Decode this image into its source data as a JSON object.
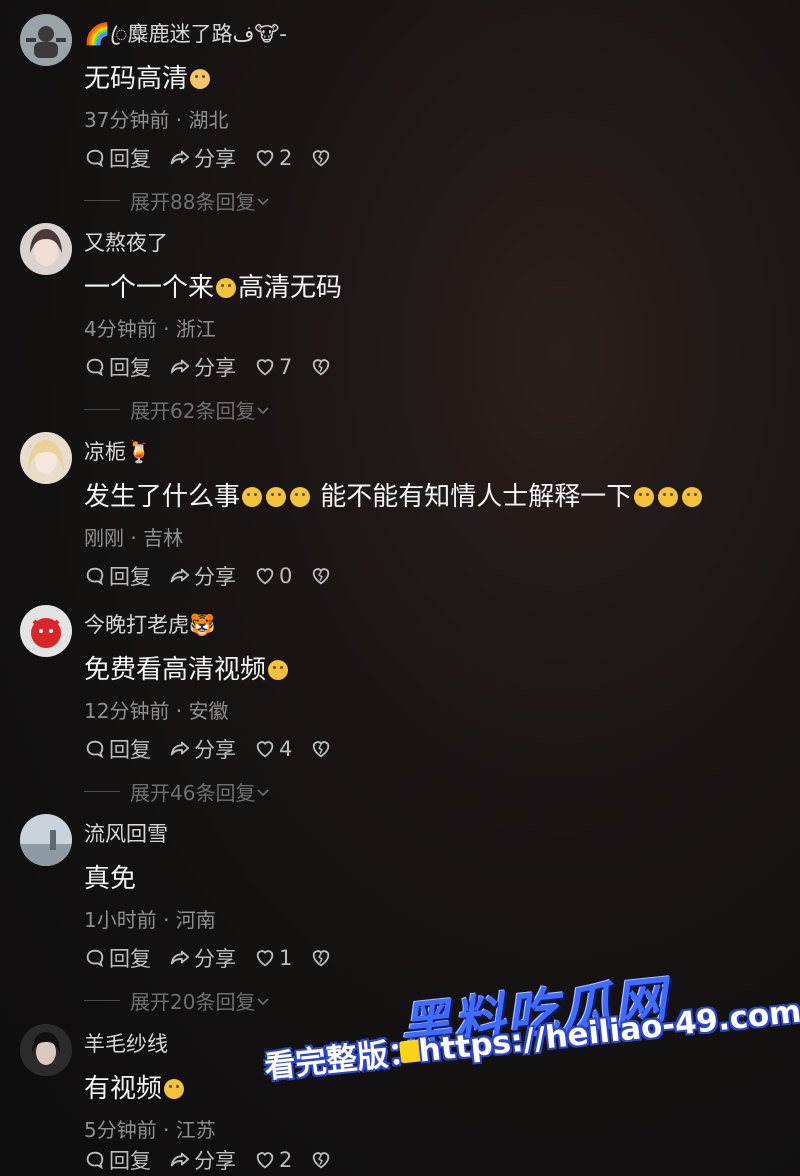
{
  "comments": [
    {
      "name": "🌈ꦿ麋鹿迷了路ف🐮-",
      "text": "无码高清",
      "emoji_after": "cat-face",
      "time_location": "37分钟前 · 湖北",
      "reply_label": "回复",
      "share_label": "分享",
      "likes": "2",
      "expand_replies": "展开88条回复"
    },
    {
      "name": "又熬夜了",
      "text_part1": "一个一个来",
      "text_part2": "高清无码",
      "time_location": "4分钟前 · 浙江",
      "reply_label": "回复",
      "share_label": "分享",
      "likes": "7",
      "expand_replies": "展开62条回复"
    },
    {
      "name": "凉栀🍹",
      "text_part1": "发生了什么事",
      "text_part2": "能不能有知情人士解释一下",
      "time_location": "刚刚 · 吉林",
      "reply_label": "回复",
      "share_label": "分享",
      "likes": "0"
    },
    {
      "name": "今晚打老虎🐯",
      "text": "免费看高清视频",
      "time_location": "12分钟前 · 安徽",
      "reply_label": "回复",
      "share_label": "分享",
      "likes": "4",
      "expand_replies": "展开46条回复"
    },
    {
      "name": "流风回雪",
      "text": "真免",
      "time_location": "1小时前 · 河南",
      "reply_label": "回复",
      "share_label": "分享",
      "likes": "1",
      "expand_replies": "展开20条回复"
    },
    {
      "name": "羊毛纱线",
      "text": "有视频",
      "time_location": "5分钟前 · 江苏",
      "reply_label": "回复",
      "share_label": "分享",
      "likes": "2"
    }
  ],
  "watermark": {
    "brand": "黑料吃瓜网",
    "line2": "看完整版：https://heiliao-49.com"
  },
  "colors": {
    "background": "#161313",
    "text_primary": "#f3f3f3",
    "text_secondary": "#8f8f8f",
    "watermark_blue": "#3f6bff"
  }
}
